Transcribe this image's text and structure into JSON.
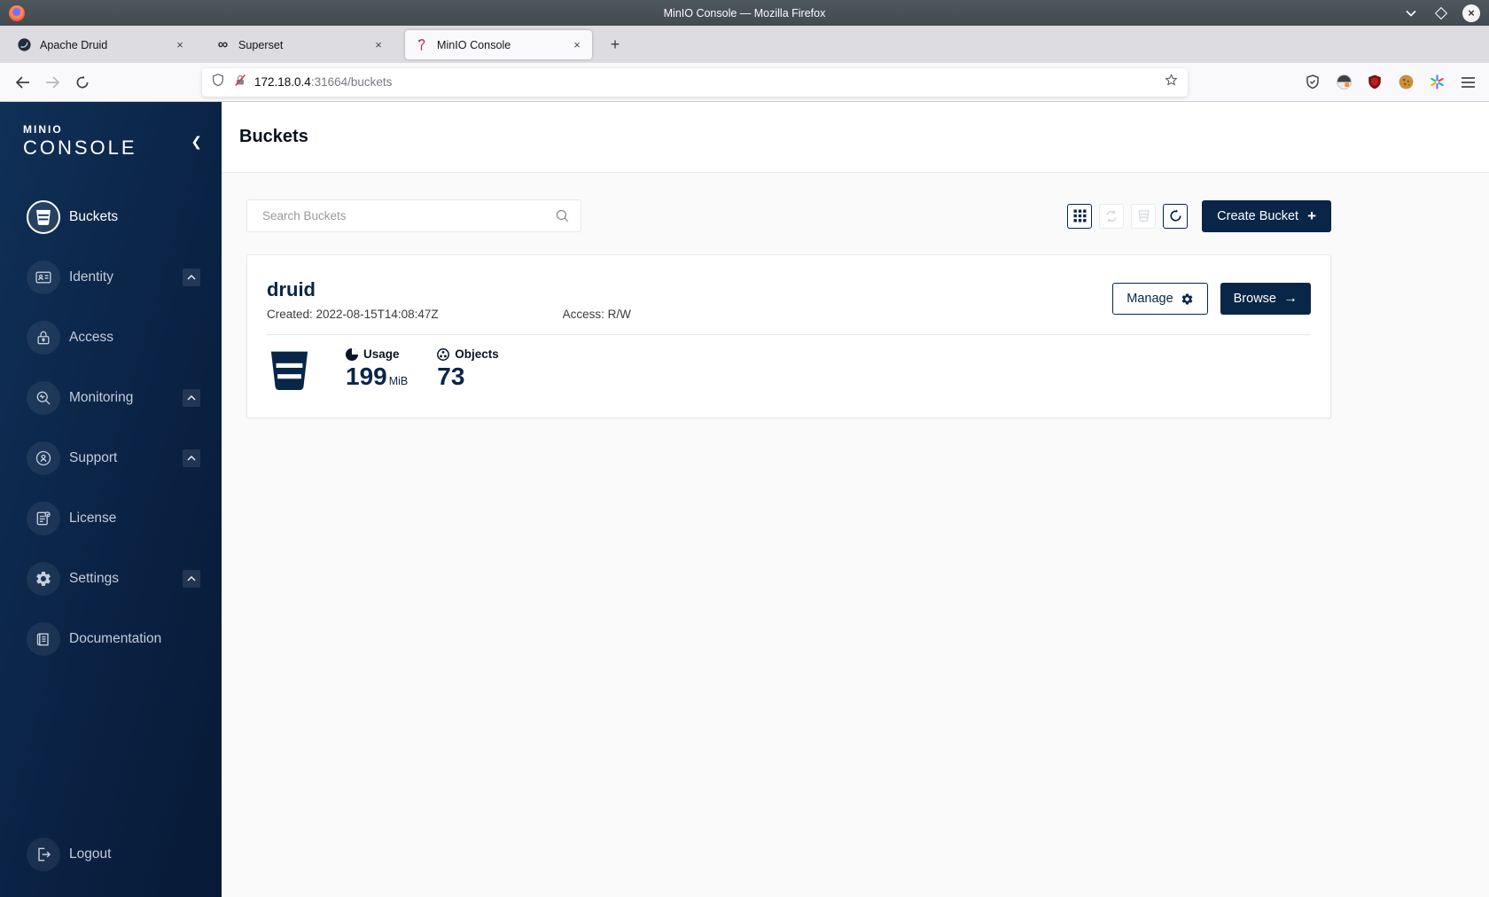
{
  "window": {
    "title": "MinIO Console — Mozilla Firefox"
  },
  "tabs": [
    {
      "label": "Apache Druid"
    },
    {
      "label": "Superset"
    },
    {
      "label": "MinIO Console"
    }
  ],
  "urlbar": {
    "host": "172.18.0.4",
    "rest": ":31664/buckets"
  },
  "sidebar": {
    "logo_line1": "MINIO",
    "logo_line2": "CONSOLE",
    "items": [
      {
        "label": "Buckets"
      },
      {
        "label": "Identity"
      },
      {
        "label": "Access"
      },
      {
        "label": "Monitoring"
      },
      {
        "label": "Support"
      },
      {
        "label": "License"
      },
      {
        "label": "Settings"
      },
      {
        "label": "Documentation"
      }
    ],
    "logout": "Logout"
  },
  "page": {
    "title": "Buckets",
    "search_placeholder": "Search Buckets",
    "create_button": "Create Bucket"
  },
  "bucket": {
    "name": "druid",
    "created": "Created: 2022-08-15T14:08:47Z",
    "access": "Access: R/W",
    "usage_label": "Usage",
    "usage_value": "199",
    "usage_unit": "MiB",
    "objects_label": "Objects",
    "objects_value": "73",
    "manage": "Manage",
    "browse": "Browse",
    "browse_arrow": "→"
  },
  "colors": {
    "navy": "#092648",
    "flamingo_red": "#C72C48",
    "sidebar_from": "#103057",
    "sidebar_to": "#071A36"
  }
}
